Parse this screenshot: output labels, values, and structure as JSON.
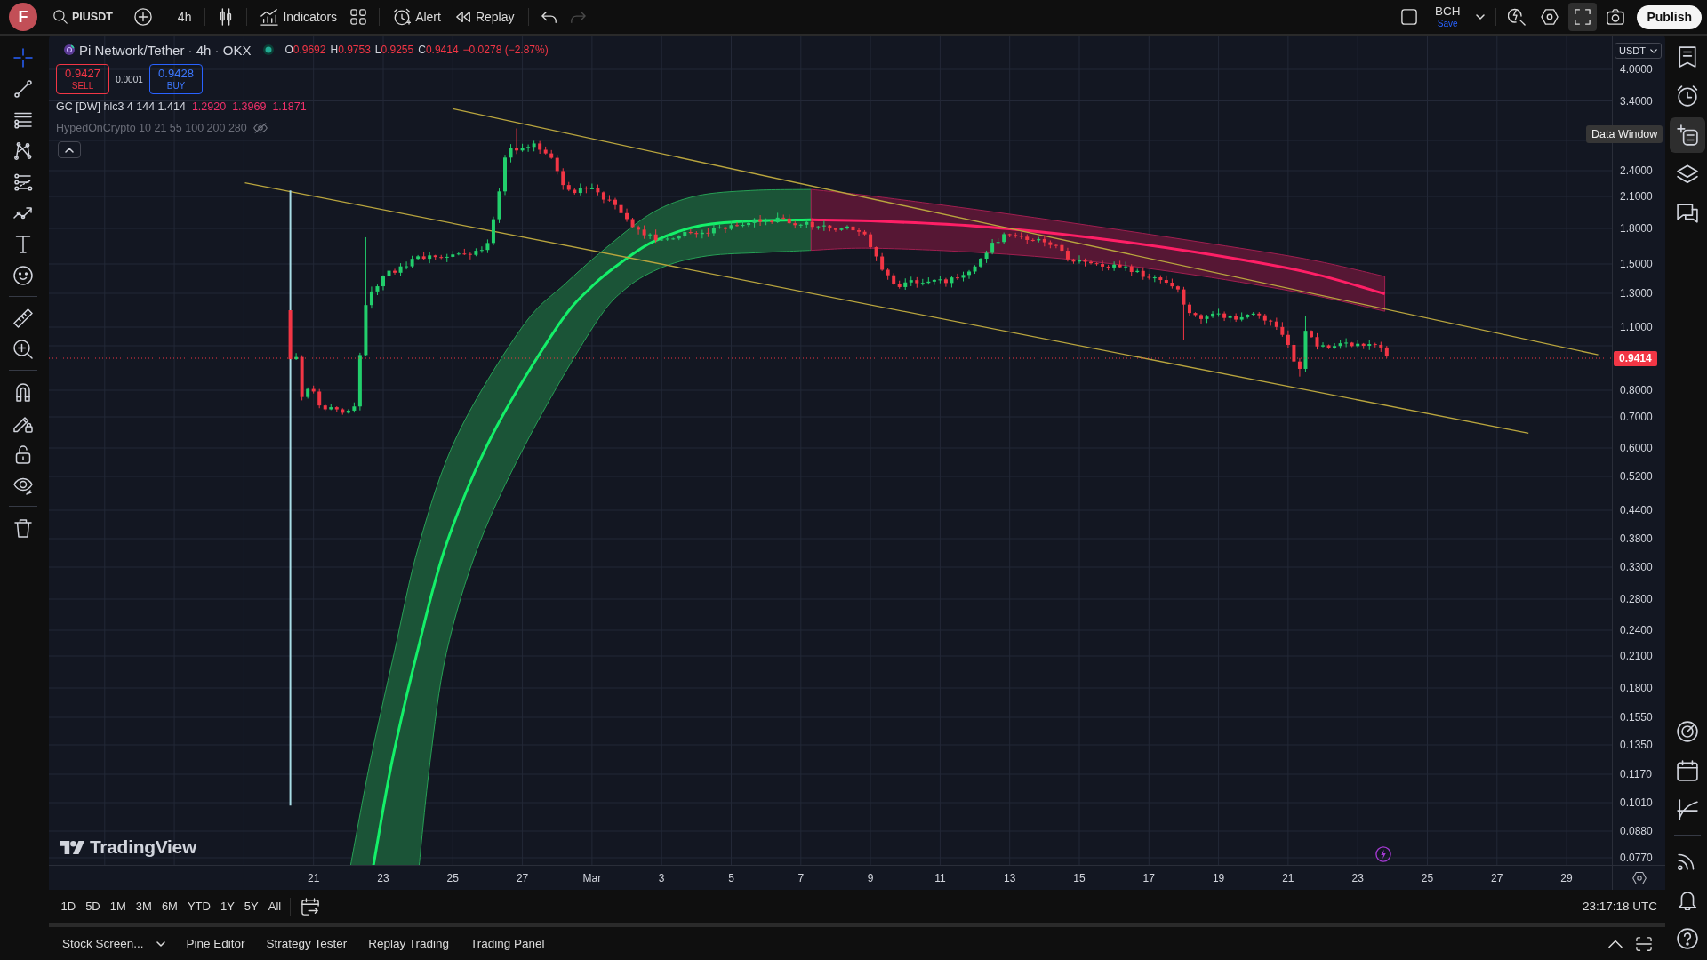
{
  "top_bar": {
    "user_initial": "F",
    "symbol": "PIUSDT",
    "interval": "4h",
    "indicators": "Indicators",
    "alert": "Alert",
    "replay": "Replay",
    "undo": {
      "disabled": false
    },
    "redo": {
      "disabled": true
    },
    "layout_name": "BCH",
    "layout_status": "Save",
    "fullscreen_active": true,
    "publish": "Publish"
  },
  "left_toolbar": {
    "groups": [
      {
        "tools": [
          {
            "kind": "crosshair",
            "selected": true
          },
          {
            "kind": "trendline",
            "selected": false
          },
          {
            "kind": "fibonacci",
            "selected": false
          },
          {
            "kind": "pattern",
            "selected": false
          },
          {
            "kind": "projection",
            "selected": false
          },
          {
            "kind": "forecast",
            "selected": false
          },
          {
            "kind": "text",
            "selected": false
          },
          {
            "kind": "emoji",
            "selected": false
          }
        ]
      },
      {
        "tools": [
          {
            "kind": "ruler",
            "selected": false
          },
          {
            "kind": "zoom",
            "selected": false
          }
        ]
      },
      {
        "tools": [
          {
            "kind": "magnet",
            "selected": false
          },
          {
            "kind": "pencil",
            "selected": false
          },
          {
            "kind": "lock",
            "selected": false
          },
          {
            "kind": "eye",
            "selected": false
          }
        ]
      },
      {
        "tools": [
          {
            "kind": "trash",
            "selected": false
          }
        ]
      }
    ]
  },
  "legend": {
    "title": "Pi Network/Tether · 4h · OKX",
    "market_open": true,
    "falling": true,
    "ohlc": [
      {
        "label": "O",
        "value": "0.9692"
      },
      {
        "label": "H",
        "value": "0.9753"
      },
      {
        "label": "L",
        "value": "0.9255"
      },
      {
        "label": "C",
        "value": "0.9414"
      }
    ],
    "change": "−0.0278 (−2.87%)",
    "sell": {
      "price": "0.9427",
      "label": "SELL"
    },
    "spread": "0.0001",
    "buy": {
      "price": "0.9428",
      "label": "BUY"
    },
    "indicators": [
      {
        "name": "GC [DW] hlc3 4 144 1.414",
        "visible": true,
        "values": [
          "1.2920",
          "1.3969",
          "1.1871"
        ]
      },
      {
        "name": "HypedOnCrypto 10 21 55 100 200 280",
        "visible": false
      }
    ],
    "expanded": true
  },
  "chart": {
    "brand": "TradingView"
  },
  "price_axis": {
    "currency": "USDT",
    "labels": [
      "4.0000",
      "3.4000",
      "2.4000",
      "2.1000",
      "1.8000",
      "1.5000",
      "1.3000",
      "1.1000",
      "0.8000",
      "0.7000",
      "0.6000",
      "0.5200",
      "0.4400",
      "0.3800",
      "0.3300",
      "0.2800",
      "0.2400",
      "0.2100",
      "0.1800",
      "0.1550",
      "0.1350",
      "0.1170",
      "0.1010",
      "0.0880",
      "0.0770"
    ],
    "last_price": "0.9414"
  },
  "time_axis": {
    "labels": [
      "21",
      "23",
      "25",
      "27",
      "Mar",
      "3",
      "5",
      "7",
      "9",
      "11",
      "13",
      "15",
      "17",
      "19",
      "21",
      "23",
      "25",
      "27",
      "29"
    ]
  },
  "range_bar": {
    "ranges": [
      "1D",
      "5D",
      "1M",
      "3M",
      "6M",
      "YTD",
      "1Y",
      "5Y",
      "All"
    ],
    "clock": "23:17:18 UTC"
  },
  "bottom_panel": {
    "tabs": [
      {
        "label": "Stock Screen...",
        "has_menu": true
      },
      {
        "label": "Pine Editor",
        "has_menu": false
      },
      {
        "label": "Strategy Tester",
        "has_menu": false
      },
      {
        "label": "Replay Trading",
        "has_menu": false
      },
      {
        "label": "Trading Panel",
        "has_menu": false
      }
    ]
  },
  "right_sidebar": {
    "groups": [
      {
        "tools": [
          {
            "kind": "watchlist",
            "selected": false
          },
          {
            "kind": "alerts",
            "selected": false
          },
          {
            "kind": "datawindow",
            "selected": true
          },
          {
            "kind": "layers",
            "selected": false
          },
          {
            "kind": "chats",
            "selected": false
          }
        ]
      },
      {
        "tools": [
          {
            "kind": "screener",
            "selected": false
          },
          {
            "kind": "calendar",
            "selected": false
          },
          {
            "kind": "pine",
            "selected": false
          }
        ]
      },
      {
        "tools": [
          {
            "kind": "news",
            "selected": false
          },
          {
            "kind": "notifications",
            "selected": false
          },
          {
            "kind": "help",
            "selected": false
          }
        ]
      }
    ]
  },
  "tooltip": "Data Window"
}
